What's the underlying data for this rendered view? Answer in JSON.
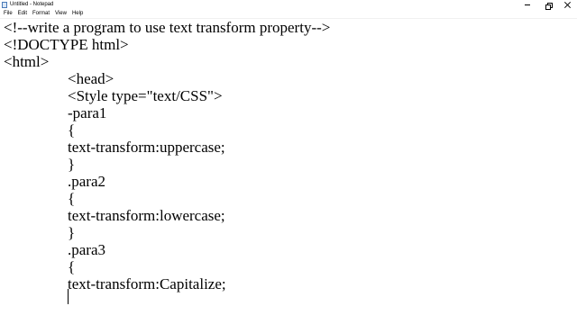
{
  "window": {
    "title": "Untitled - Notepad",
    "app_icon": "notepad-icon",
    "controls": {
      "minimize_icon": "minimize-icon",
      "maximize_icon": "restore-icon",
      "close_icon": "close-icon"
    }
  },
  "menu": {
    "items": [
      "File",
      "Edit",
      "Format",
      "View",
      "Help"
    ]
  },
  "editor": {
    "lines": [
      "<!--write a program to use text transform property-->",
      "<!DOCTYPE html>",
      "<html>",
      "<head>",
      "<Style type=\"text/CSS\">",
      "-para1",
      "{",
      "text-transform:uppercase;",
      "}",
      ".para2",
      "{",
      "text-transform:lowercase;",
      "}",
      ".para3",
      "{",
      "text-transform:Capitalize;"
    ]
  }
}
